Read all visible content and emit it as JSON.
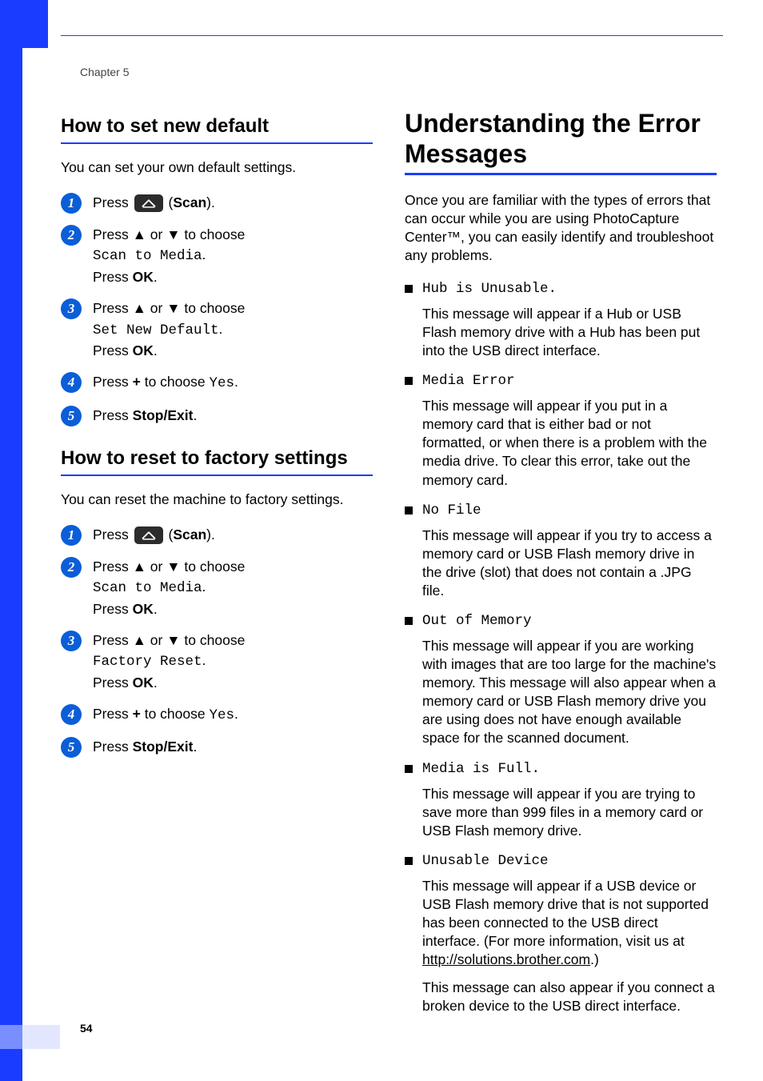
{
  "chapter": "Chapter 5",
  "page_number": "54",
  "left": {
    "section1": {
      "title": "How to set new default",
      "intro": "You can set your own default settings.",
      "steps": {
        "s1": {
          "press": "Press ",
          "scan": "Scan"
        },
        "s2": {
          "line1a": "Press ",
          "line1b": " or ",
          "line1c": " to choose ",
          "mono": "Scan to Media",
          "dot": ".",
          "press": "Press ",
          "ok": "OK",
          "dot2": "."
        },
        "s3": {
          "line1a": "Press ",
          "line1b": " or ",
          "line1c": " to choose ",
          "mono": "Set New Default",
          "dot": ".",
          "press": "Press ",
          "ok": "OK",
          "dot2": "."
        },
        "s4": {
          "press": "Press ",
          "plus": "+",
          "tochoose": " to choose ",
          "mono": "Yes",
          "dot": "."
        },
        "s5": {
          "press": "Press ",
          "stop": "Stop/Exit",
          "dot": "."
        }
      }
    },
    "section2": {
      "title": "How to reset to factory settings",
      "intro": "You can reset the machine to factory settings.",
      "steps": {
        "s1": {
          "press": "Press ",
          "scan": "Scan"
        },
        "s2": {
          "line1a": "Press ",
          "line1b": " or ",
          "line1c": " to choose ",
          "mono": "Scan to Media",
          "dot": ".",
          "press": "Press ",
          "ok": "OK",
          "dot2": "."
        },
        "s3": {
          "line1a": "Press ",
          "line1b": " or ",
          "line1c": " to choose ",
          "mono": "Factory Reset",
          "dot": ".",
          "press": "Press ",
          "ok": "OK",
          "dot2": "."
        },
        "s4": {
          "press": "Press ",
          "plus": "+",
          "tochoose": " to choose ",
          "mono": "Yes",
          "dot": "."
        },
        "s5": {
          "press": "Press ",
          "stop": "Stop/Exit",
          "dot": "."
        }
      }
    }
  },
  "right": {
    "title": "Understanding the Error Messages",
    "intro": "Once you are familiar with the types of errors that can occur while you are using PhotoCapture Center™, you can easily identify and troubleshoot any problems.",
    "errors": {
      "e1": {
        "head": "Hub is Unusable.",
        "body": "This message will appear if a Hub or USB Flash memory drive with a Hub has been put into the USB direct interface."
      },
      "e2": {
        "head": "Media Error",
        "body": "This message will appear if you put in a memory card that is either bad or not formatted, or when there is a problem with the media drive. To clear this error, take out the memory card."
      },
      "e3": {
        "head": "No File",
        "body": "This message will appear if you try to access a memory card or USB Flash memory drive in the drive (slot) that does not contain a .JPG file."
      },
      "e4": {
        "head": "Out of Memory",
        "body": "This message will appear if you are working with images that are too large for the machine's memory. This message will also appear when a memory card or USB Flash memory drive you are using does not have enough available space for the scanned document."
      },
      "e5": {
        "head": "Media is Full.",
        "body": "This message will appear if you are trying to save more than 999 files in a memory card or USB Flash memory drive."
      },
      "e6": {
        "head": "Unusable Device",
        "body1a": "This message will appear if a USB device or USB Flash memory drive that is not supported has been connected to the USB direct interface. (For more information, visit us at ",
        "link": "http://solutions.brother.com",
        "body1b": ".)",
        "body2": "This message can also appear if you connect a broken device to the USB direct interface."
      }
    }
  },
  "glyphs": {
    "up": "▲",
    "down": "▼"
  }
}
